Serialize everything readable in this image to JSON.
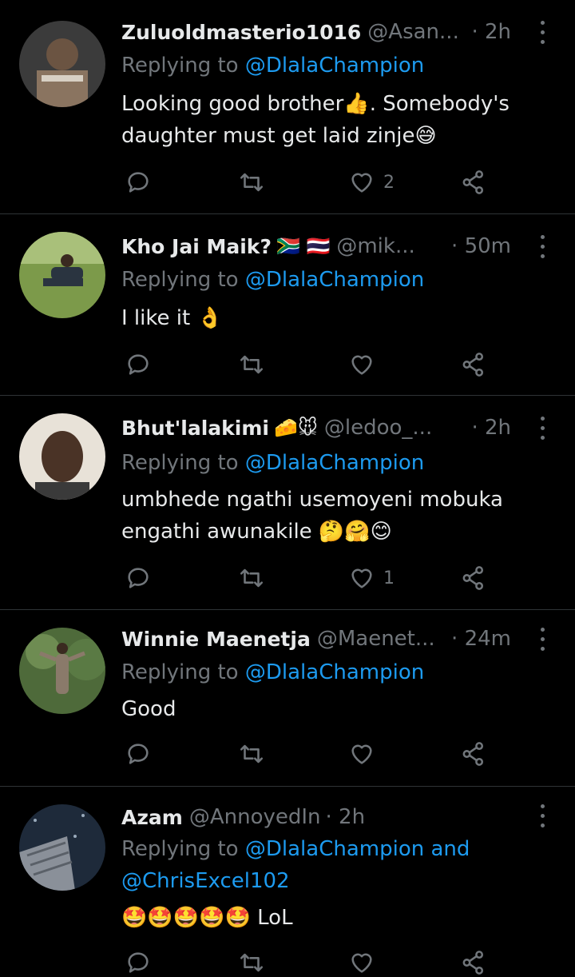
{
  "colors": {
    "background": "#000000",
    "text": "#e7e9ea",
    "muted": "#71767b",
    "link": "#1d9bf0",
    "divider": "#2f3336"
  },
  "tweets": [
    {
      "name": "Zuluoldmasterio1016",
      "name_emoji": "",
      "handle": "@Asan...",
      "time": "· 2h",
      "reply_prefix": "Replying to ",
      "reply_to": "@DlalaChampion",
      "reply_to_2": "",
      "text": "Looking good brother👍. Somebody's daughter must get laid zinje😅",
      "likes": "2"
    },
    {
      "name": "Kho Jai Maik?",
      "name_emoji": "🇿🇦 🇹🇭",
      "handle": "@mik...",
      "time": "· 50m",
      "reply_prefix": "Replying to ",
      "reply_to": "@DlalaChampion",
      "reply_to_2": "",
      "text": "I like it 👌",
      "likes": ""
    },
    {
      "name": "Bhut'lalakimi",
      "name_emoji": "🧀🐭",
      "handle": "@ledoo_...",
      "time": "· 2h",
      "reply_prefix": "Replying to ",
      "reply_to": "@DlalaChampion",
      "reply_to_2": "",
      "text": "umbhede ngathi usemoyeni mobuka engathi awunakile 🤔🤗😊",
      "likes": "1"
    },
    {
      "name": "Winnie Maenetja",
      "name_emoji": "",
      "handle": "@Maenet...",
      "time": "· 24m",
      "reply_prefix": "Replying to ",
      "reply_to": "@DlalaChampion",
      "reply_to_2": "",
      "text": "Good",
      "likes": ""
    },
    {
      "name": "Azam",
      "name_emoji": "",
      "handle": "@AnnoyedIn",
      "time": "· 2h",
      "reply_prefix": "Replying to ",
      "reply_to": "@DlalaChampion and",
      "reply_to_2": "@ChrisExcel102",
      "text": "🤩🤩🤩🤩🤩 LoL",
      "likes": ""
    }
  ],
  "icons": {
    "reply": "reply-icon",
    "retweet": "retweet-icon",
    "like": "like-icon",
    "share": "share-icon",
    "more": "more-options-icon"
  }
}
